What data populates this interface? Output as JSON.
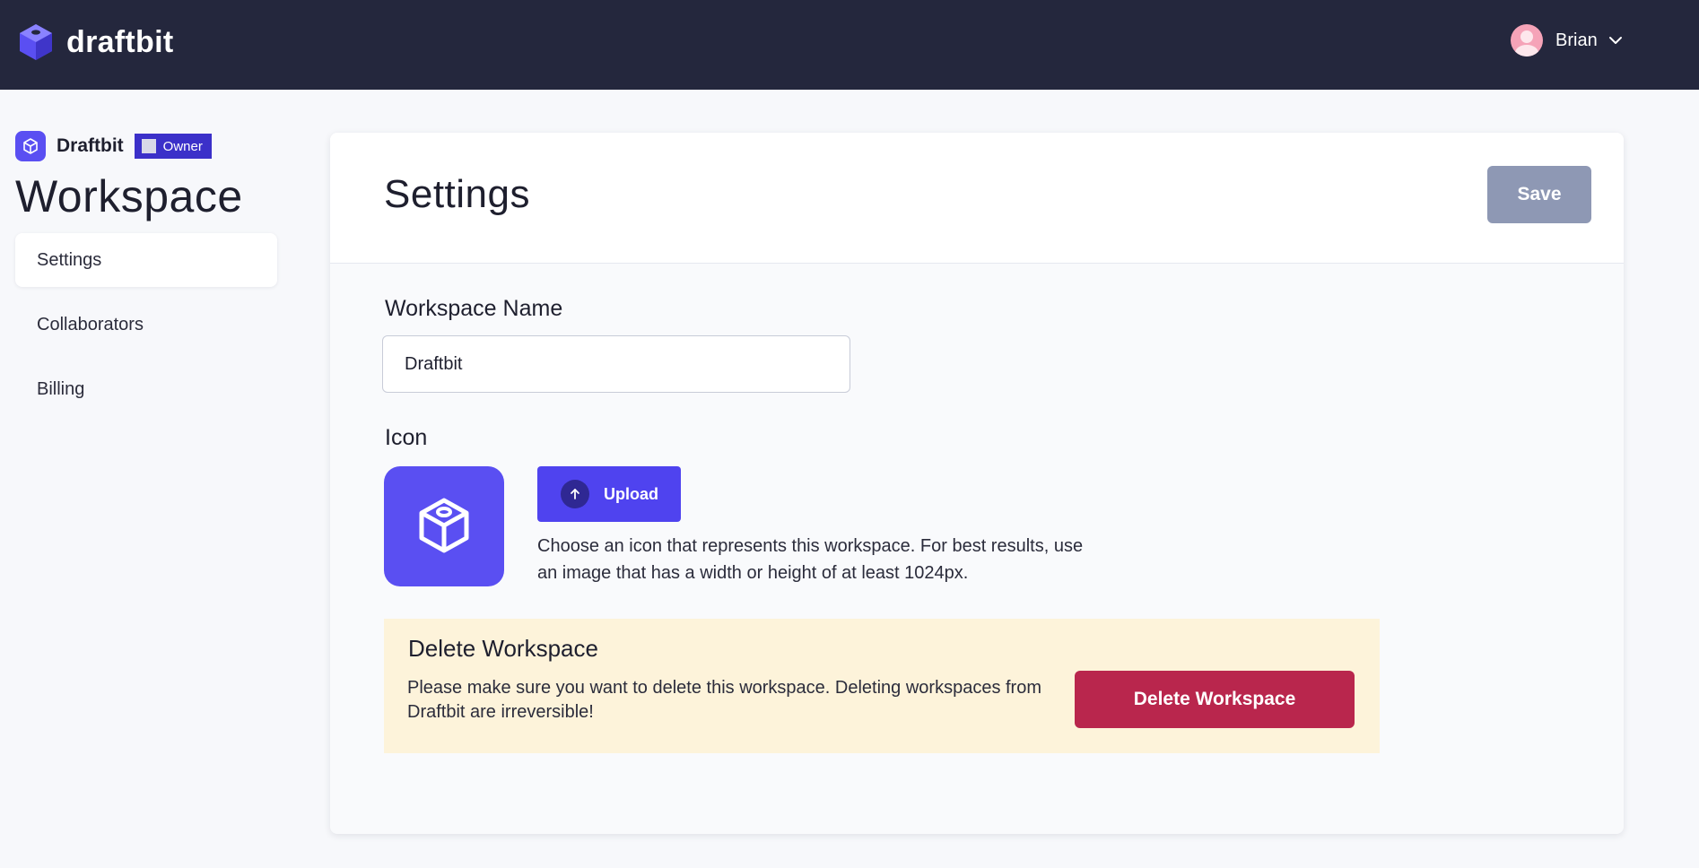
{
  "app": {
    "brand_name": "draftbit",
    "user_name": "Brian"
  },
  "sidebar": {
    "workspace_name": "Draftbit",
    "role_badge": "Owner",
    "title": "Workspace",
    "items": [
      {
        "label": "Settings",
        "active": true
      },
      {
        "label": "Collaborators",
        "active": false
      },
      {
        "label": "Billing",
        "active": false
      }
    ]
  },
  "main": {
    "title": "Settings",
    "save_label": "Save",
    "workspace_name_label": "Workspace Name",
    "workspace_name_value": "Draftbit",
    "icon_label": "Icon",
    "upload_label": "Upload",
    "icon_help": "Choose an icon that represents this workspace. For best results, use an image that has a width or height of at least 1024px."
  },
  "danger": {
    "title": "Delete Workspace",
    "text": "Please make sure you want to delete this workspace. Deleting workspaces from Draftbit are irreversible!",
    "button_label": "Delete Workspace"
  },
  "colors": {
    "topbar": "#24273d",
    "accent": "#5a4ff2",
    "save_disabled": "#8e98b4",
    "danger": "#b9264d",
    "warning_bg": "#fdf3da"
  },
  "icons": {
    "brand": "cube-logo-icon",
    "avatar": "user-avatar-icon",
    "chevron": "chevron-down-icon",
    "upload": "arrow-up-icon",
    "workspace": "cube-icon"
  }
}
